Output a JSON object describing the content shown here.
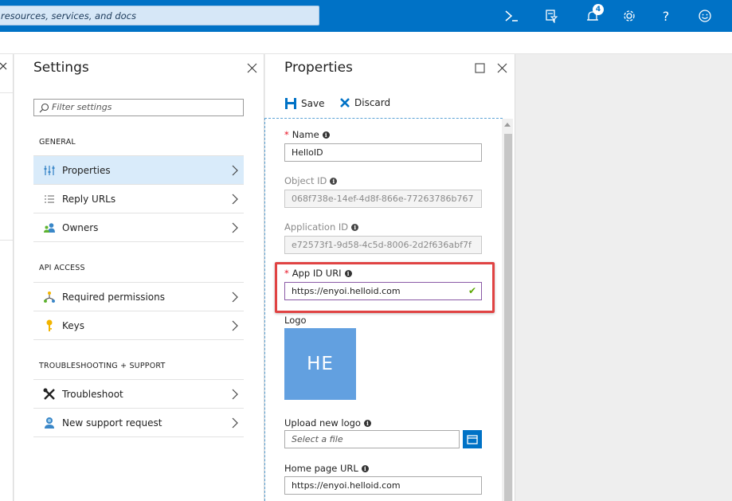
{
  "topbar": {
    "search_text": "resources, services, and docs",
    "notification_count": "4",
    "icons": [
      "cloud-shell-icon",
      "directory-filter-icon",
      "notifications-icon",
      "settings-icon",
      "help-icon",
      "feedback-smiley-icon"
    ],
    "help_glyph": "?",
    "accent": "#0072c6"
  },
  "settings": {
    "title": "Settings",
    "filter_placeholder": "Filter settings",
    "sections": [
      {
        "heading": "GENERAL",
        "items": [
          "Properties",
          "Reply URLs",
          "Owners"
        ]
      },
      {
        "heading": "API ACCESS",
        "items": [
          "Required permissions",
          "Keys"
        ]
      },
      {
        "heading": "TROUBLESHOOTING + SUPPORT",
        "items": [
          "Troubleshoot",
          "New support request"
        ]
      }
    ]
  },
  "properties": {
    "title": "Properties",
    "save_label": "Save",
    "discard_label": "Discard",
    "fields": {
      "name": {
        "label": "Name",
        "value": "HelloID",
        "required": true
      },
      "object_id": {
        "label": "Object ID",
        "value": "068f738e-14ef-4d8f-866e-77263786b767"
      },
      "application_id": {
        "label": "Application ID",
        "value": "e72573f1-9d58-4c5d-8006-2d2f636abf7f"
      },
      "app_id_uri": {
        "label": "App ID URI",
        "value": "https://enyoi.helloid.com",
        "required": true
      },
      "logo": {
        "label": "Logo",
        "initials": "HE"
      },
      "upload_logo": {
        "label": "Upload new logo",
        "placeholder": "Select a file"
      },
      "home_page_url": {
        "label": "Home page URL",
        "value": "https://enyoi.helloid.com"
      }
    },
    "required_mark": "*",
    "info_glyph": "i",
    "valid_glyph": "✔"
  }
}
